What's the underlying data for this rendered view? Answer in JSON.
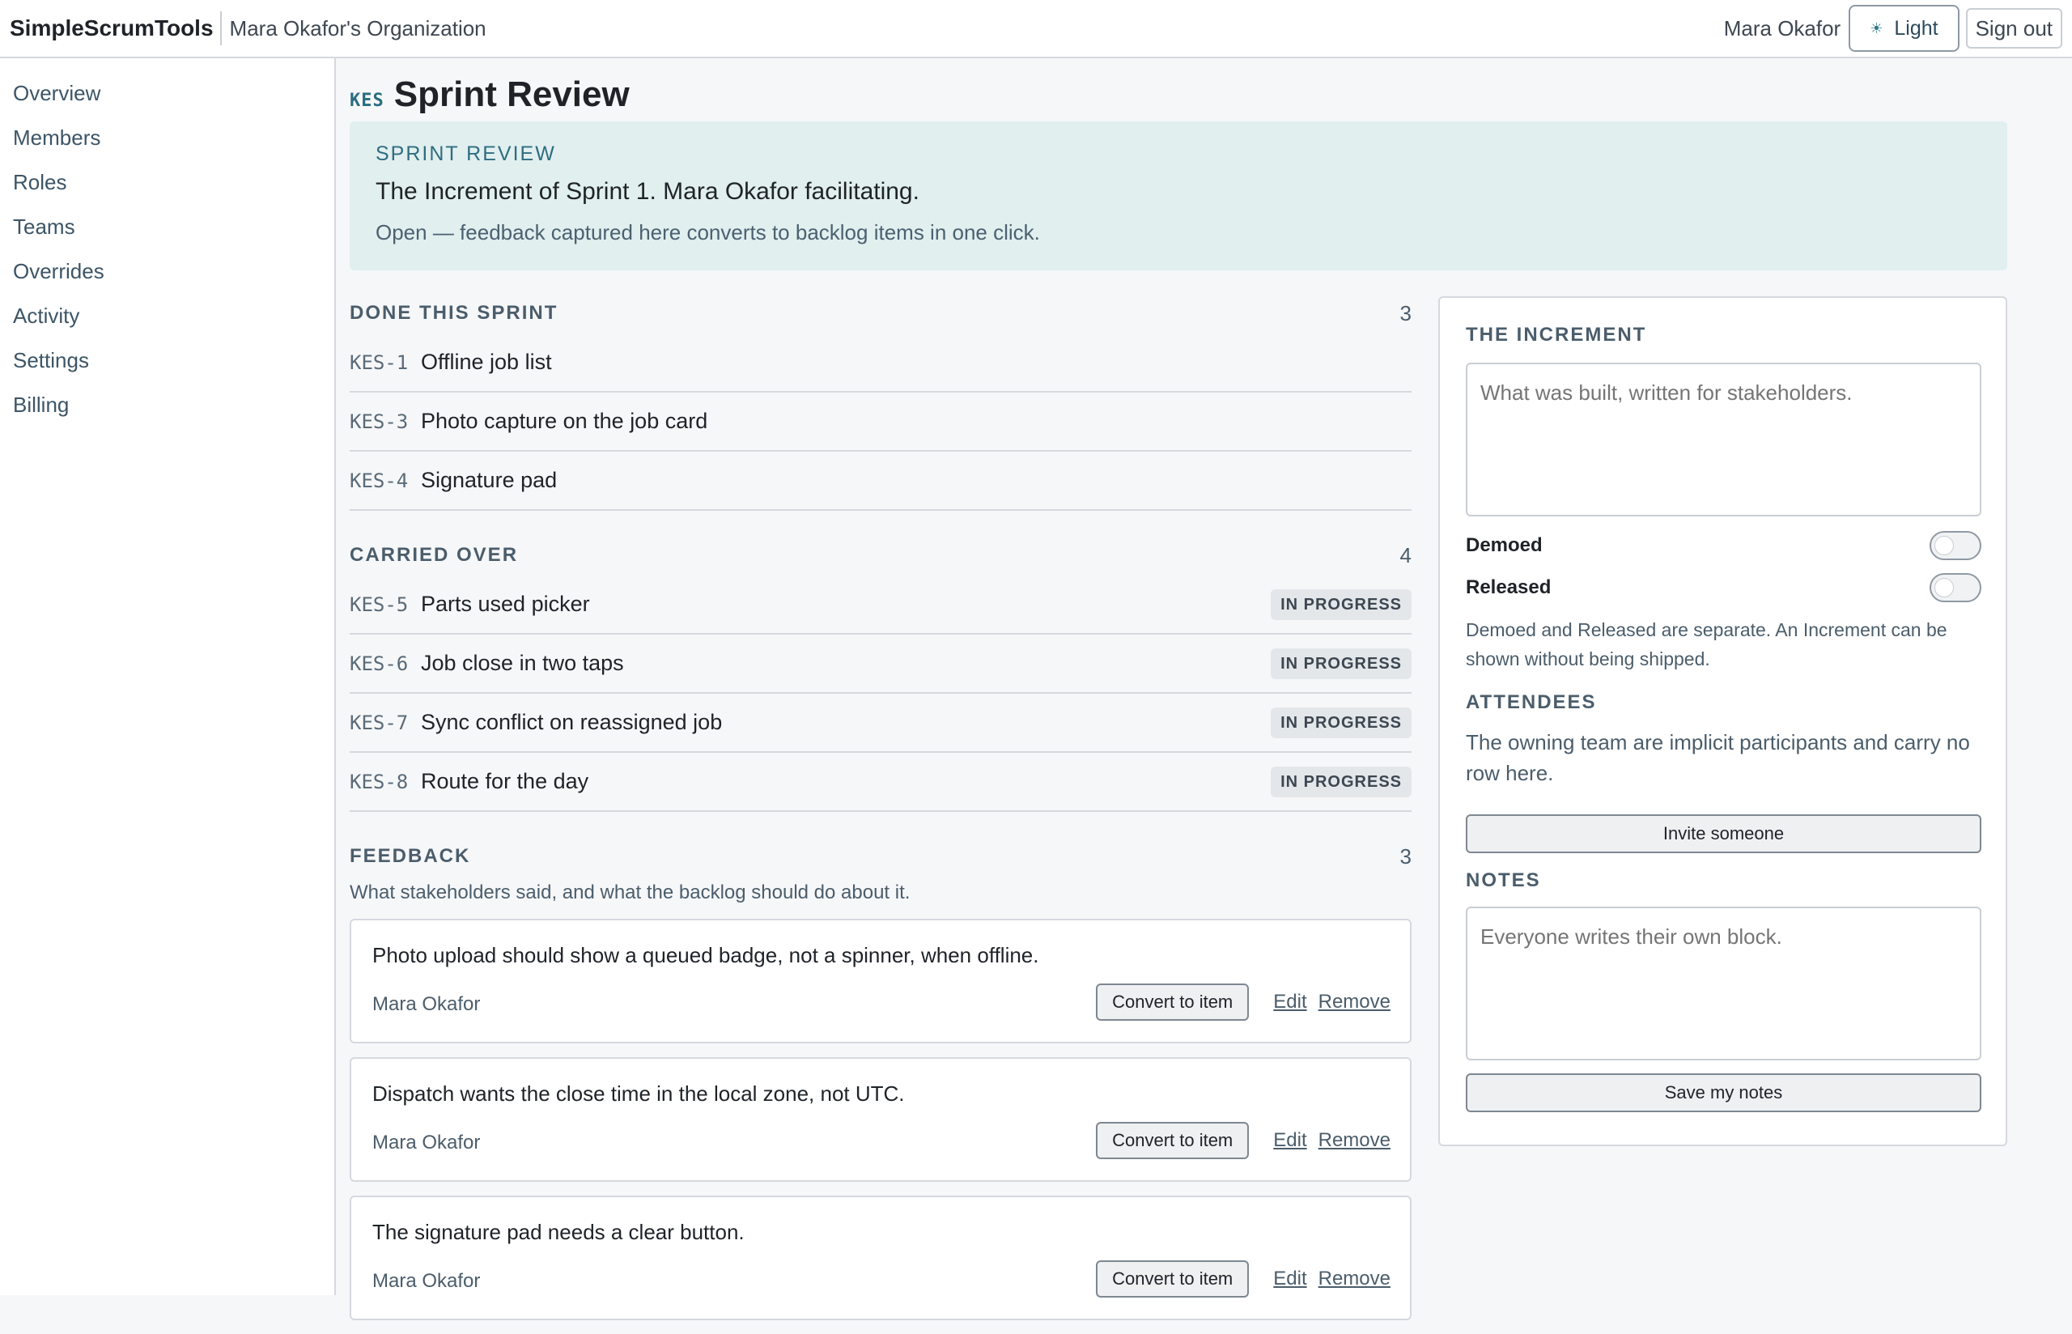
{
  "header": {
    "app_name": "SimpleScrumTools",
    "org_name": "Mara Okafor's Organization",
    "user_name": "Mara Okafor",
    "theme_icon": "sun-icon",
    "theme_label": "Light",
    "signout_label": "Sign out"
  },
  "sidebar": {
    "items": [
      {
        "label": "Overview"
      },
      {
        "label": "Members"
      },
      {
        "label": "Roles"
      },
      {
        "label": "Teams"
      },
      {
        "label": "Overrides"
      },
      {
        "label": "Activity"
      },
      {
        "label": "Settings"
      },
      {
        "label": "Billing"
      }
    ]
  },
  "page": {
    "project_key": "KES",
    "title": "Sprint Review"
  },
  "banner": {
    "eyebrow": "SPRINT REVIEW",
    "headline": "The Increment of Sprint 1. Mara Okafor facilitating.",
    "subtext": "Open — feedback captured here converts to backlog items in one click."
  },
  "done": {
    "title": "DONE THIS SPRINT",
    "count": "3",
    "items": [
      {
        "key": "KES-1",
        "title": "Offline job list"
      },
      {
        "key": "KES-3",
        "title": "Photo capture on the job card"
      },
      {
        "key": "KES-4",
        "title": "Signature pad"
      }
    ]
  },
  "carried": {
    "title": "CARRIED OVER",
    "count": "4",
    "items": [
      {
        "key": "KES-5",
        "title": "Parts used picker",
        "status": "IN PROGRESS"
      },
      {
        "key": "KES-6",
        "title": "Job close in two taps",
        "status": "IN PROGRESS"
      },
      {
        "key": "KES-7",
        "title": "Sync conflict on reassigned job",
        "status": "IN PROGRESS"
      },
      {
        "key": "KES-8",
        "title": "Route for the day",
        "status": "IN PROGRESS"
      }
    ]
  },
  "feedback": {
    "title": "FEEDBACK",
    "count": "3",
    "description": "What stakeholders said, and what the backlog should do about it.",
    "convert_label": "Convert to item",
    "edit_label": "Edit",
    "remove_label": "Remove",
    "items": [
      {
        "text": "Photo upload should show a queued badge, not a spinner, when offline.",
        "author": "Mara Okafor"
      },
      {
        "text": "Dispatch wants the close time in the local zone, not UTC.",
        "author": "Mara Okafor"
      },
      {
        "text": "The signature pad needs a clear button.",
        "author": "Mara Okafor"
      }
    ]
  },
  "increment": {
    "title": "THE INCREMENT",
    "placeholder": "What was built, written for stakeholders.",
    "demoed_label": "Demoed",
    "demoed": false,
    "released_label": "Released",
    "released": false,
    "note": "Demoed and Released are separate. An Increment can be shown without being shipped."
  },
  "attendees": {
    "title": "ATTENDEES",
    "text": "The owning team are implicit participants and carry no row here.",
    "invite_label": "Invite someone"
  },
  "notes": {
    "title": "NOTES",
    "placeholder": "Everyone writes their own block.",
    "save_label": "Save my notes"
  }
}
